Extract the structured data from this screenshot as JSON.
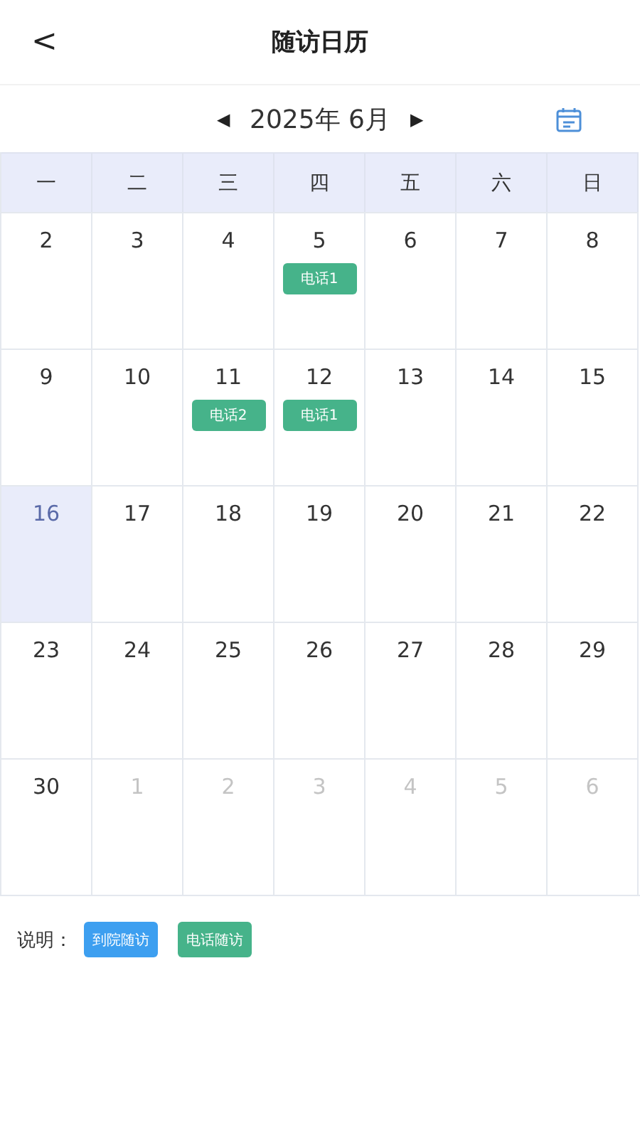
{
  "header": {
    "back": "<",
    "title": "随访日历"
  },
  "month_bar": {
    "prev": "◀",
    "label": "2025年 6月",
    "next": "▶"
  },
  "weekdays": [
    "一",
    "二",
    "三",
    "四",
    "五",
    "六",
    "日"
  ],
  "days": [
    {
      "day": "2",
      "kind": "current",
      "selected": false
    },
    {
      "day": "3",
      "kind": "current",
      "selected": false
    },
    {
      "day": "4",
      "kind": "current",
      "selected": false
    },
    {
      "day": "5",
      "kind": "current",
      "selected": false,
      "events": [
        {
          "label": "电话1",
          "kind": "phone"
        }
      ]
    },
    {
      "day": "6",
      "kind": "current",
      "selected": false
    },
    {
      "day": "7",
      "kind": "current",
      "selected": false
    },
    {
      "day": "8",
      "kind": "current",
      "selected": false
    },
    {
      "day": "9",
      "kind": "current",
      "selected": false
    },
    {
      "day": "10",
      "kind": "current",
      "selected": false
    },
    {
      "day": "11",
      "kind": "current",
      "selected": false,
      "events": [
        {
          "label": "电话2",
          "kind": "phone"
        }
      ]
    },
    {
      "day": "12",
      "kind": "current",
      "selected": false,
      "events": [
        {
          "label": "电话1",
          "kind": "phone"
        }
      ]
    },
    {
      "day": "13",
      "kind": "current",
      "selected": false
    },
    {
      "day": "14",
      "kind": "current",
      "selected": false
    },
    {
      "day": "15",
      "kind": "current",
      "selected": false
    },
    {
      "day": "16",
      "kind": "current",
      "selected": true
    },
    {
      "day": "17",
      "kind": "current",
      "selected": false
    },
    {
      "day": "18",
      "kind": "current",
      "selected": false
    },
    {
      "day": "19",
      "kind": "current",
      "selected": false
    },
    {
      "day": "20",
      "kind": "current",
      "selected": false
    },
    {
      "day": "21",
      "kind": "current",
      "selected": false
    },
    {
      "day": "22",
      "kind": "current",
      "selected": false
    },
    {
      "day": "23",
      "kind": "current",
      "selected": false
    },
    {
      "day": "24",
      "kind": "current",
      "selected": false
    },
    {
      "day": "25",
      "kind": "current",
      "selected": false
    },
    {
      "day": "26",
      "kind": "current",
      "selected": false
    },
    {
      "day": "27",
      "kind": "current",
      "selected": false
    },
    {
      "day": "28",
      "kind": "current",
      "selected": false
    },
    {
      "day": "29",
      "kind": "current",
      "selected": false
    },
    {
      "day": "30",
      "kind": "current",
      "selected": false
    },
    {
      "day": "1",
      "kind": "other",
      "selected": false
    },
    {
      "day": "2",
      "kind": "other",
      "selected": false
    },
    {
      "day": "3",
      "kind": "other",
      "selected": false
    },
    {
      "day": "4",
      "kind": "other",
      "selected": false
    },
    {
      "day": "5",
      "kind": "other",
      "selected": false
    },
    {
      "day": "6",
      "kind": "other",
      "selected": false
    }
  ],
  "legend": {
    "label": "说明：",
    "items": [
      {
        "label": "到院随访",
        "kind": "visit"
      },
      {
        "label": "电话随访",
        "kind": "phone"
      }
    ]
  }
}
